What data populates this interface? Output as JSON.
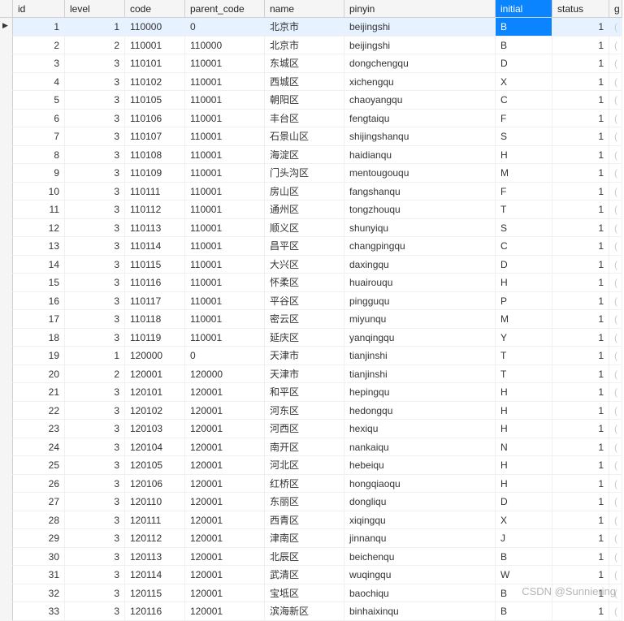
{
  "columns": [
    {
      "key": "id",
      "label": "id",
      "align": "num"
    },
    {
      "key": "level",
      "label": "level",
      "align": "num"
    },
    {
      "key": "code",
      "label": "code",
      "align": "txt"
    },
    {
      "key": "parent_code",
      "label": "parent_code",
      "align": "txt"
    },
    {
      "key": "name",
      "label": "name",
      "align": "txt"
    },
    {
      "key": "pinyin",
      "label": "pinyin",
      "align": "txt"
    },
    {
      "key": "initial",
      "label": "initial",
      "align": "txt"
    },
    {
      "key": "status",
      "label": "status",
      "align": "num"
    },
    {
      "key": "g",
      "label": "g",
      "align": "txt"
    }
  ],
  "selected_row_index": 0,
  "selected_column_key": "initial",
  "rows": [
    {
      "id": 1,
      "level": 1,
      "code": "110000",
      "parent_code": "0",
      "name": "北京市",
      "pinyin": "beijingshi",
      "initial": "B",
      "status": 1,
      "g": "("
    },
    {
      "id": 2,
      "level": 2,
      "code": "110001",
      "parent_code": "110000",
      "name": "北京市",
      "pinyin": "beijingshi",
      "initial": "B",
      "status": 1,
      "g": "("
    },
    {
      "id": 3,
      "level": 3,
      "code": "110101",
      "parent_code": "110001",
      "name": "东城区",
      "pinyin": "dongchengqu",
      "initial": "D",
      "status": 1,
      "g": "("
    },
    {
      "id": 4,
      "level": 3,
      "code": "110102",
      "parent_code": "110001",
      "name": "西城区",
      "pinyin": "xichengqu",
      "initial": "X",
      "status": 1,
      "g": "("
    },
    {
      "id": 5,
      "level": 3,
      "code": "110105",
      "parent_code": "110001",
      "name": "朝阳区",
      "pinyin": "chaoyangqu",
      "initial": "C",
      "status": 1,
      "g": "("
    },
    {
      "id": 6,
      "level": 3,
      "code": "110106",
      "parent_code": "110001",
      "name": "丰台区",
      "pinyin": "fengtaiqu",
      "initial": "F",
      "status": 1,
      "g": "("
    },
    {
      "id": 7,
      "level": 3,
      "code": "110107",
      "parent_code": "110001",
      "name": "石景山区",
      "pinyin": "shijingshanqu",
      "initial": "S",
      "status": 1,
      "g": "("
    },
    {
      "id": 8,
      "level": 3,
      "code": "110108",
      "parent_code": "110001",
      "name": "海淀区",
      "pinyin": "haidianqu",
      "initial": "H",
      "status": 1,
      "g": "("
    },
    {
      "id": 9,
      "level": 3,
      "code": "110109",
      "parent_code": "110001",
      "name": "门头沟区",
      "pinyin": "mentougouqu",
      "initial": "M",
      "status": 1,
      "g": "("
    },
    {
      "id": 10,
      "level": 3,
      "code": "110111",
      "parent_code": "110001",
      "name": "房山区",
      "pinyin": "fangshanqu",
      "initial": "F",
      "status": 1,
      "g": "("
    },
    {
      "id": 11,
      "level": 3,
      "code": "110112",
      "parent_code": "110001",
      "name": "通州区",
      "pinyin": "tongzhouqu",
      "initial": "T",
      "status": 1,
      "g": "("
    },
    {
      "id": 12,
      "level": 3,
      "code": "110113",
      "parent_code": "110001",
      "name": "顺义区",
      "pinyin": "shunyiqu",
      "initial": "S",
      "status": 1,
      "g": "("
    },
    {
      "id": 13,
      "level": 3,
      "code": "110114",
      "parent_code": "110001",
      "name": "昌平区",
      "pinyin": "changpingqu",
      "initial": "C",
      "status": 1,
      "g": "("
    },
    {
      "id": 14,
      "level": 3,
      "code": "110115",
      "parent_code": "110001",
      "name": "大兴区",
      "pinyin": "daxingqu",
      "initial": "D",
      "status": 1,
      "g": "("
    },
    {
      "id": 15,
      "level": 3,
      "code": "110116",
      "parent_code": "110001",
      "name": "怀柔区",
      "pinyin": "huairouqu",
      "initial": "H",
      "status": 1,
      "g": "("
    },
    {
      "id": 16,
      "level": 3,
      "code": "110117",
      "parent_code": "110001",
      "name": "平谷区",
      "pinyin": "pingguqu",
      "initial": "P",
      "status": 1,
      "g": "("
    },
    {
      "id": 17,
      "level": 3,
      "code": "110118",
      "parent_code": "110001",
      "name": "密云区",
      "pinyin": "miyunqu",
      "initial": "M",
      "status": 1,
      "g": "("
    },
    {
      "id": 18,
      "level": 3,
      "code": "110119",
      "parent_code": "110001",
      "name": "延庆区",
      "pinyin": "yanqingqu",
      "initial": "Y",
      "status": 1,
      "g": "("
    },
    {
      "id": 19,
      "level": 1,
      "code": "120000",
      "parent_code": "0",
      "name": "天津市",
      "pinyin": "tianjinshi",
      "initial": "T",
      "status": 1,
      "g": "("
    },
    {
      "id": 20,
      "level": 2,
      "code": "120001",
      "parent_code": "120000",
      "name": "天津市",
      "pinyin": "tianjinshi",
      "initial": "T",
      "status": 1,
      "g": "("
    },
    {
      "id": 21,
      "level": 3,
      "code": "120101",
      "parent_code": "120001",
      "name": "和平区",
      "pinyin": "hepingqu",
      "initial": "H",
      "status": 1,
      "g": "("
    },
    {
      "id": 22,
      "level": 3,
      "code": "120102",
      "parent_code": "120001",
      "name": "河东区",
      "pinyin": "hedongqu",
      "initial": "H",
      "status": 1,
      "g": "("
    },
    {
      "id": 23,
      "level": 3,
      "code": "120103",
      "parent_code": "120001",
      "name": "河西区",
      "pinyin": "hexiqu",
      "initial": "H",
      "status": 1,
      "g": "("
    },
    {
      "id": 24,
      "level": 3,
      "code": "120104",
      "parent_code": "120001",
      "name": "南开区",
      "pinyin": "nankaiqu",
      "initial": "N",
      "status": 1,
      "g": "("
    },
    {
      "id": 25,
      "level": 3,
      "code": "120105",
      "parent_code": "120001",
      "name": "河北区",
      "pinyin": "hebeiqu",
      "initial": "H",
      "status": 1,
      "g": "("
    },
    {
      "id": 26,
      "level": 3,
      "code": "120106",
      "parent_code": "120001",
      "name": "红桥区",
      "pinyin": "hongqiaoqu",
      "initial": "H",
      "status": 1,
      "g": "("
    },
    {
      "id": 27,
      "level": 3,
      "code": "120110",
      "parent_code": "120001",
      "name": "东丽区",
      "pinyin": "dongliqu",
      "initial": "D",
      "status": 1,
      "g": "("
    },
    {
      "id": 28,
      "level": 3,
      "code": "120111",
      "parent_code": "120001",
      "name": "西青区",
      "pinyin": "xiqingqu",
      "initial": "X",
      "status": 1,
      "g": "("
    },
    {
      "id": 29,
      "level": 3,
      "code": "120112",
      "parent_code": "120001",
      "name": "津南区",
      "pinyin": "jinnanqu",
      "initial": "J",
      "status": 1,
      "g": "("
    },
    {
      "id": 30,
      "level": 3,
      "code": "120113",
      "parent_code": "120001",
      "name": "北辰区",
      "pinyin": "beichenqu",
      "initial": "B",
      "status": 1,
      "g": "("
    },
    {
      "id": 31,
      "level": 3,
      "code": "120114",
      "parent_code": "120001",
      "name": "武清区",
      "pinyin": "wuqingqu",
      "initial": "W",
      "status": 1,
      "g": "("
    },
    {
      "id": 32,
      "level": 3,
      "code": "120115",
      "parent_code": "120001",
      "name": "宝坻区",
      "pinyin": "baochiqu",
      "initial": "B",
      "status": 1,
      "g": "("
    },
    {
      "id": 33,
      "level": 3,
      "code": "120116",
      "parent_code": "120001",
      "name": "滨海新区",
      "pinyin": "binhaixinqu",
      "initial": "B",
      "status": 1,
      "g": "("
    }
  ],
  "watermark": "CSDN @Sunniering"
}
